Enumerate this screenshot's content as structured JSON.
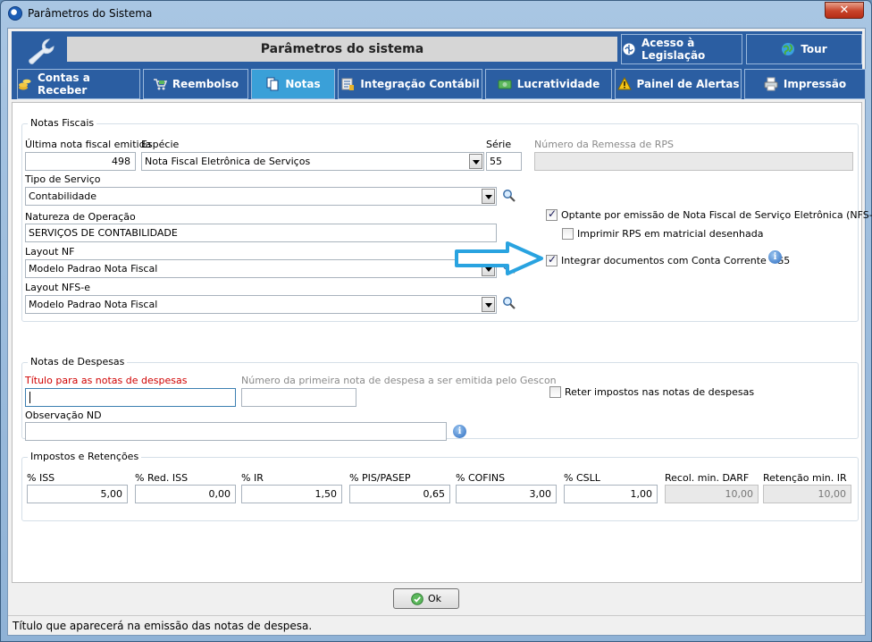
{
  "window": {
    "title": "Parâmetros do Sistema",
    "close_glyph": "✕"
  },
  "header": {
    "title": "Parâmetros do sistema",
    "buttons": {
      "legislacao": "Acesso à Legislação",
      "tour": "Tour"
    }
  },
  "tabs": [
    {
      "label": "Contas a Receber",
      "icon": "coins-icon"
    },
    {
      "label": "Reembolso",
      "icon": "cart-icon"
    },
    {
      "label": "Notas",
      "icon": "documents-icon",
      "active": true
    },
    {
      "label": "Integração Contábil",
      "icon": "ledger-icon"
    },
    {
      "label": "Lucratividade",
      "icon": "money-icon"
    },
    {
      "label": "Painel de Alertas",
      "icon": "warning-icon"
    },
    {
      "label": "Impressão",
      "icon": "printer-icon"
    }
  ],
  "notas_fiscais": {
    "group_label": "Notas Fiscais",
    "ultima_nota": {
      "label": "Última nota fiscal emitida",
      "value": "498"
    },
    "especie": {
      "label": "Espécie",
      "value": "Nota Fiscal Eletrônica de Serviços"
    },
    "serie": {
      "label": "Série",
      "value": "55"
    },
    "remessa_rps": {
      "label": "Número da Remessa de RPS",
      "value": ""
    },
    "tipo_servico": {
      "label": "Tipo de Serviço",
      "value": "Contabilidade"
    },
    "natureza": {
      "label": "Natureza de Operação",
      "value": "SERVIÇOS DE CONTABILIDADE"
    },
    "layout_nf": {
      "label": "Layout NF",
      "value": "Modelo Padrao Nota Fiscal"
    },
    "layout_nfse": {
      "label": "Layout NFS-e",
      "value": "Modelo Padrao Nota Fiscal"
    },
    "optante_nfse": {
      "label": "Optante por emissão de Nota Fiscal de Serviço Eletrônica (NFS-e)",
      "checked": true
    },
    "imprimir_rps": {
      "label": "Imprimir RPS em matricial desenhada",
      "checked": false
    },
    "integrar_docs": {
      "label": "Integrar documentos com Conta Corrente - G5",
      "checked": true
    }
  },
  "notas_despesas": {
    "group_label": "Notas de Despesas",
    "titulo": {
      "label": "Título para as notas de despesas",
      "value": ""
    },
    "primeira_nota": {
      "label": "Número da primeira nota de despesa a ser emitida pelo Gescon",
      "value": ""
    },
    "reter_impostos": {
      "label": "Reter impostos nas notas de despesas",
      "checked": false
    },
    "observacao": {
      "label": "Observação ND",
      "value": ""
    }
  },
  "impostos": {
    "group_label": "Impostos e Retenções",
    "fields": [
      {
        "label": "% ISS",
        "value": "5,00"
      },
      {
        "label": "% Red. ISS",
        "value": "0,00"
      },
      {
        "label": "% IR",
        "value": "1,50"
      },
      {
        "label": "% PIS/PASEP",
        "value": "0,65"
      },
      {
        "label": "% COFINS",
        "value": "3,00"
      },
      {
        "label": "% CSLL",
        "value": "1,00"
      },
      {
        "label": "Recol. min. DARF",
        "value": "10,00",
        "disabled": true
      },
      {
        "label": "Retenção min. IR",
        "value": "10,00",
        "disabled": true
      }
    ]
  },
  "footer": {
    "ok_label": "Ok",
    "status_text": "Título que aparecerá na emissão das notas de despesa."
  },
  "colors": {
    "header_blue": "#2b5ea2",
    "active_tab": "#3aa0d8",
    "arrow": "#29a3e0",
    "required_label": "#d00000"
  }
}
